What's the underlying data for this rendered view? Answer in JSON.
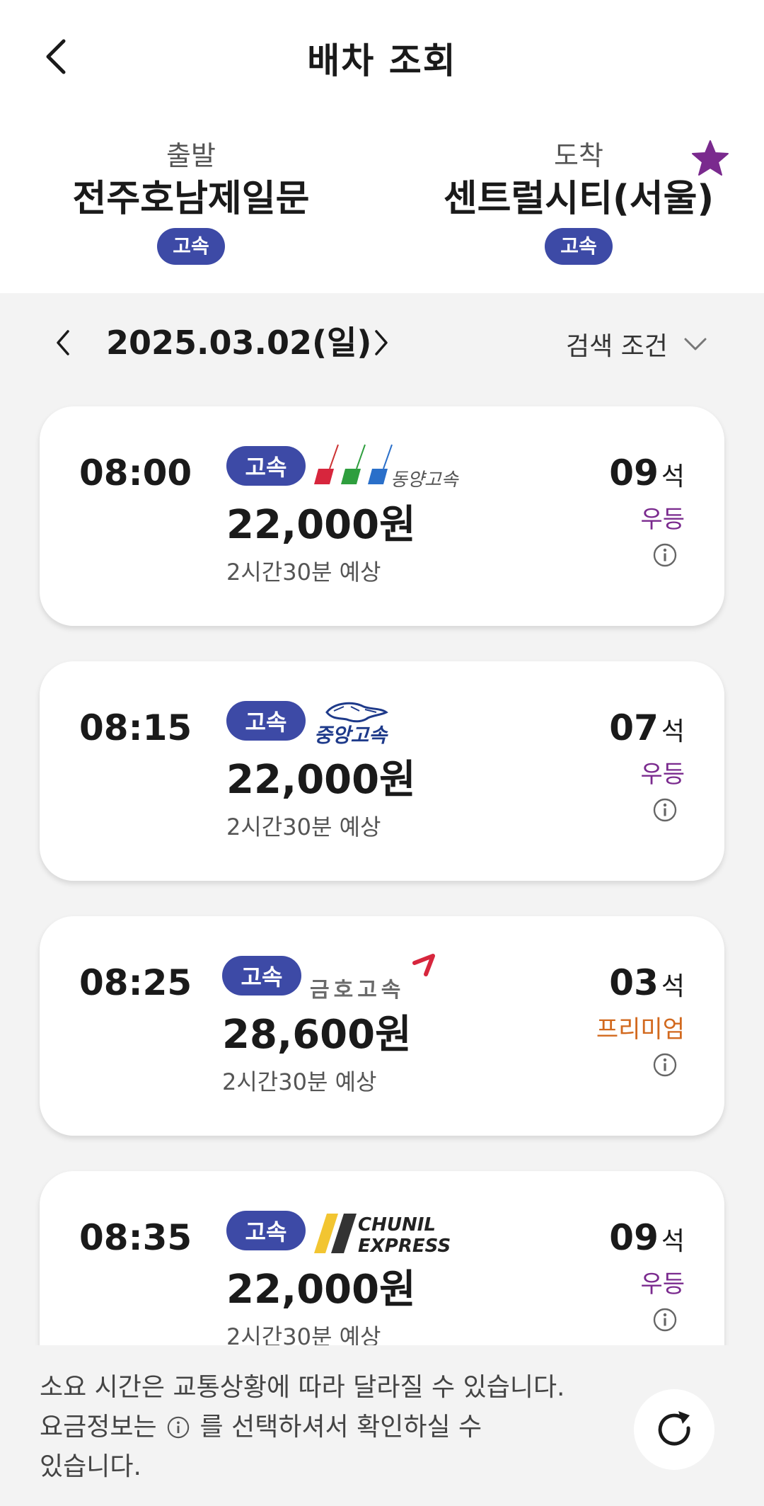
{
  "header": {
    "title": "배차 조회",
    "departure": {
      "label": "출발",
      "name": "전주호남제일문",
      "type": "고속"
    },
    "arrival": {
      "label": "도착",
      "name": "센트럴시티(서울)",
      "type": "고속"
    }
  },
  "date_bar": {
    "date": "2025.03.02(일)",
    "filter_label": "검색 조건"
  },
  "schedules": [
    {
      "time": "08:00",
      "type": "고속",
      "company": "동양고속",
      "price": "22,000원",
      "duration": "2시간30분 예상",
      "seats": "09",
      "seat_unit": "석",
      "grade": "우등"
    },
    {
      "time": "08:15",
      "type": "고속",
      "company": "중앙고속",
      "price": "22,000원",
      "duration": "2시간30분 예상",
      "seats": "07",
      "seat_unit": "석",
      "grade": "우등"
    },
    {
      "time": "08:25",
      "type": "고속",
      "company": "금호고속",
      "price": "28,600원",
      "duration": "2시간30분 예상",
      "seats": "03",
      "seat_unit": "석",
      "grade": "프리미엄"
    },
    {
      "time": "08:35",
      "type": "고속",
      "company_line1": "CHUNIL",
      "company_line2": "EXPRESS",
      "price": "22,000원",
      "duration": "2시간30분 예상",
      "seats": "09",
      "seat_unit": "석",
      "grade": "우등"
    }
  ],
  "footer": {
    "note_part1": "소요 시간은 교통상황에 따라 달라질 수 있습니다.",
    "note_part2": "요금정보는",
    "note_part3": "를 선택하셔서 확인하실 수",
    "note_part4": "있습니다."
  },
  "colors": {
    "pill": "#3d4aa6",
    "star": "#7a2a8e",
    "grade_udeung": "#7a2a8e",
    "grade_premium": "#d2691e"
  }
}
